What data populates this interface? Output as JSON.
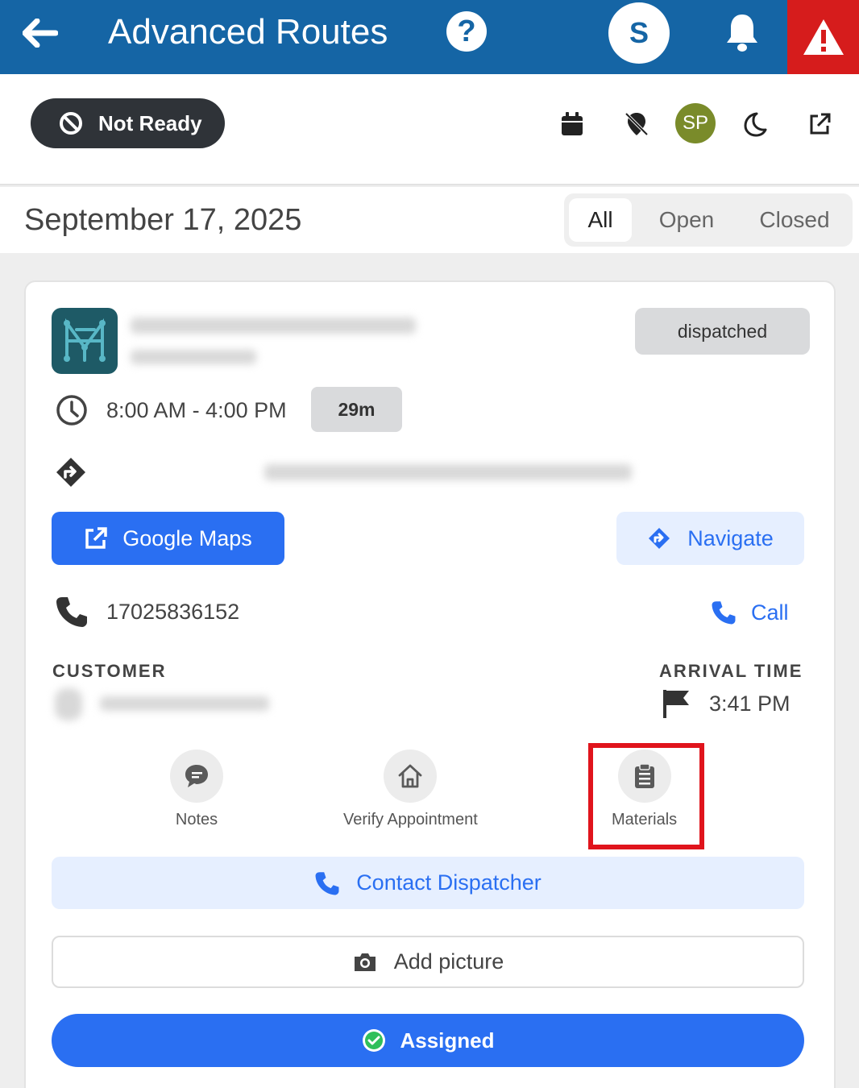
{
  "topbar": {
    "title": "Advanced Routes",
    "help_icon": "question-icon",
    "user_initial": "S",
    "bell_icon": "bell-icon",
    "alert_icon": "warning-icon"
  },
  "subbar": {
    "status_label": "Not Ready",
    "status_icon": "ban-icon",
    "avatar_initials": "SP",
    "icons": [
      "calendar-icon",
      "map-pin-off-icon",
      "moon-icon",
      "external-link-icon"
    ]
  },
  "date_row": {
    "date": "September 17, 2025",
    "filters": [
      "All",
      "Open",
      "Closed"
    ],
    "active_filter": "All"
  },
  "job": {
    "status_badge": "dispatched",
    "time_window": "8:00 AM - 4:00 PM",
    "duration": "29m",
    "google_maps_label": "Google Maps",
    "navigate_label": "Navigate",
    "phone": "17025836152",
    "call_label": "Call",
    "customer_label": "CUSTOMER",
    "arrival_label": "ARRIVAL TIME",
    "arrival_time": "3:41 PM",
    "actions": [
      {
        "label": "Notes",
        "icon": "chat-bubble-icon"
      },
      {
        "label": "Verify Appointment",
        "icon": "home-icon"
      },
      {
        "label": "Materials",
        "icon": "clipboard-icon"
      }
    ],
    "contact_dispatcher_label": "Contact Dispatcher",
    "add_picture_label": "Add picture",
    "assigned_label": "Assigned"
  },
  "colors": {
    "topbar": "#1565a5",
    "alert": "#d61c1c",
    "primary": "#2a6ff2",
    "highlight": "#e0141c"
  }
}
